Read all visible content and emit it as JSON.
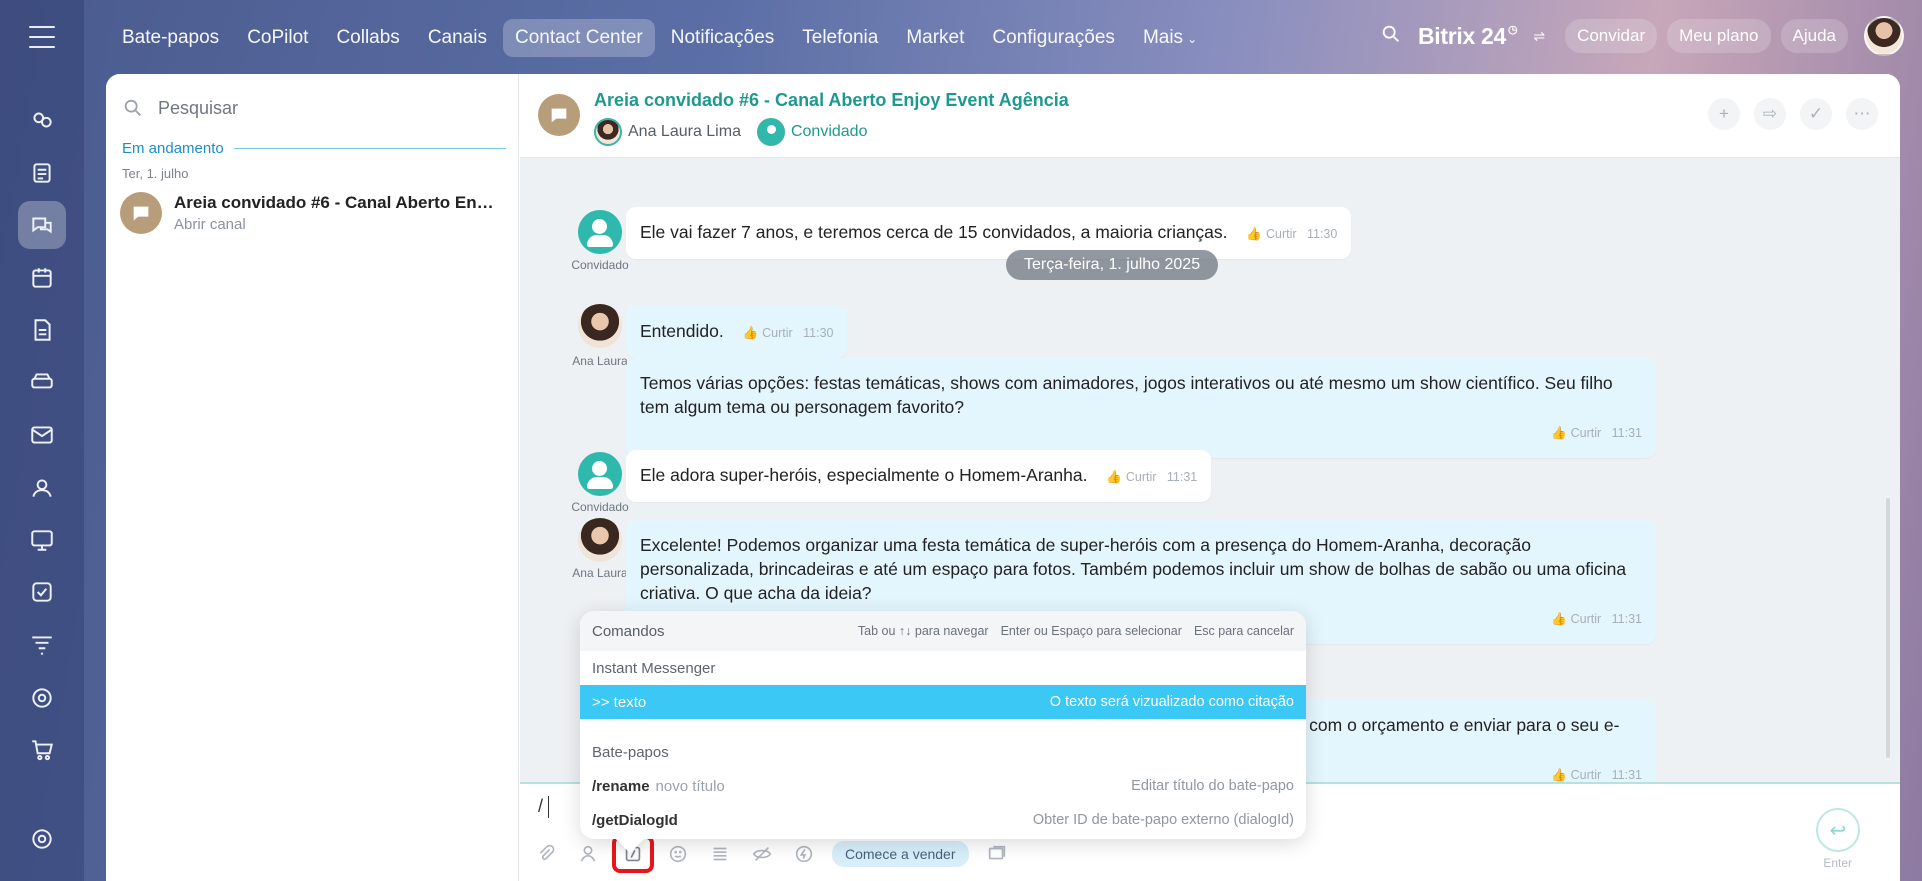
{
  "topnav": {
    "items": [
      "Bate-papos",
      "CoPilot",
      "Collabs",
      "Canais",
      "Contact Center",
      "Notificações",
      "Telefonia",
      "Market",
      "Configurações",
      "Mais"
    ],
    "brand": "Bitrix 24",
    "invite": "Convidar",
    "plan": "Meu plano",
    "help": "Ajuda"
  },
  "sidebar": {
    "search_placeholder": "Pesquisar",
    "section": "Em andamento",
    "date": "Ter, 1. julho",
    "recent": {
      "title": "Areia convidado #6 - Canal Aberto Enj...",
      "subtitle": "Abrir canal"
    }
  },
  "chat": {
    "title": "Areia convidado #6 - Canal Aberto Enjoy Event Agência",
    "member_agent": "Ana Laura Lima",
    "member_guest": "Convidado",
    "date_pill": "Terça-feira, 1. julho 2025",
    "like_label": "Curtir",
    "labels": {
      "guest": "Convidado",
      "agent": "Ana Laura"
    },
    "messages": [
      {
        "text": "Ele vai fazer 7 anos, e teremos cerca de 15 convidados, a maioria crianças.",
        "time": "11:30"
      },
      {
        "text": "Entendido.",
        "time": "11:30"
      },
      {
        "text": "Temos várias opções: festas temáticas, shows com animadores, jogos interativos ou até mesmo um show científico. Seu filho tem algum tema ou personagem favorito?",
        "time": "11:31"
      },
      {
        "text": "Ele adora super-heróis, especialmente o Homem-Aranha.",
        "time": "11:31"
      },
      {
        "text": "Excelente! Podemos organizar uma festa temática de super-heróis com a presença do Homem-Aranha, decoração personalizada, brincadeiras e até um espaço para fotos. Também podemos incluir um show de bolhas de sabão ou uma oficina criativa. O que acha da ideia?",
        "time": "11:31"
      },
      {
        "text": "oposta detalhada com o orçamento e enviar para o seu e-mail.",
        "time": "11:31"
      }
    ]
  },
  "input": {
    "value": "/",
    "sell_button": "Comece a vender",
    "send_label": "Enter"
  },
  "commands": {
    "title": "Comandos",
    "hint_nav": "Tab ou ↑↓ para navegar",
    "hint_select": "Enter ou Espaço para selecionar",
    "hint_cancel": "Esc para cancelar",
    "group_im": "Instant Messenger",
    "quote_cmd": ">>  texto",
    "quote_desc": "O texto será vizualizado como citação",
    "group_chats": "Bate-papos",
    "rename_cmd": "/rename",
    "rename_arg": "novo título",
    "rename_desc": "Editar título do bate-papo",
    "dialog_cmd": "/getDialogId",
    "dialog_desc": "Obter ID de bate-papo externo (dialogId)"
  }
}
